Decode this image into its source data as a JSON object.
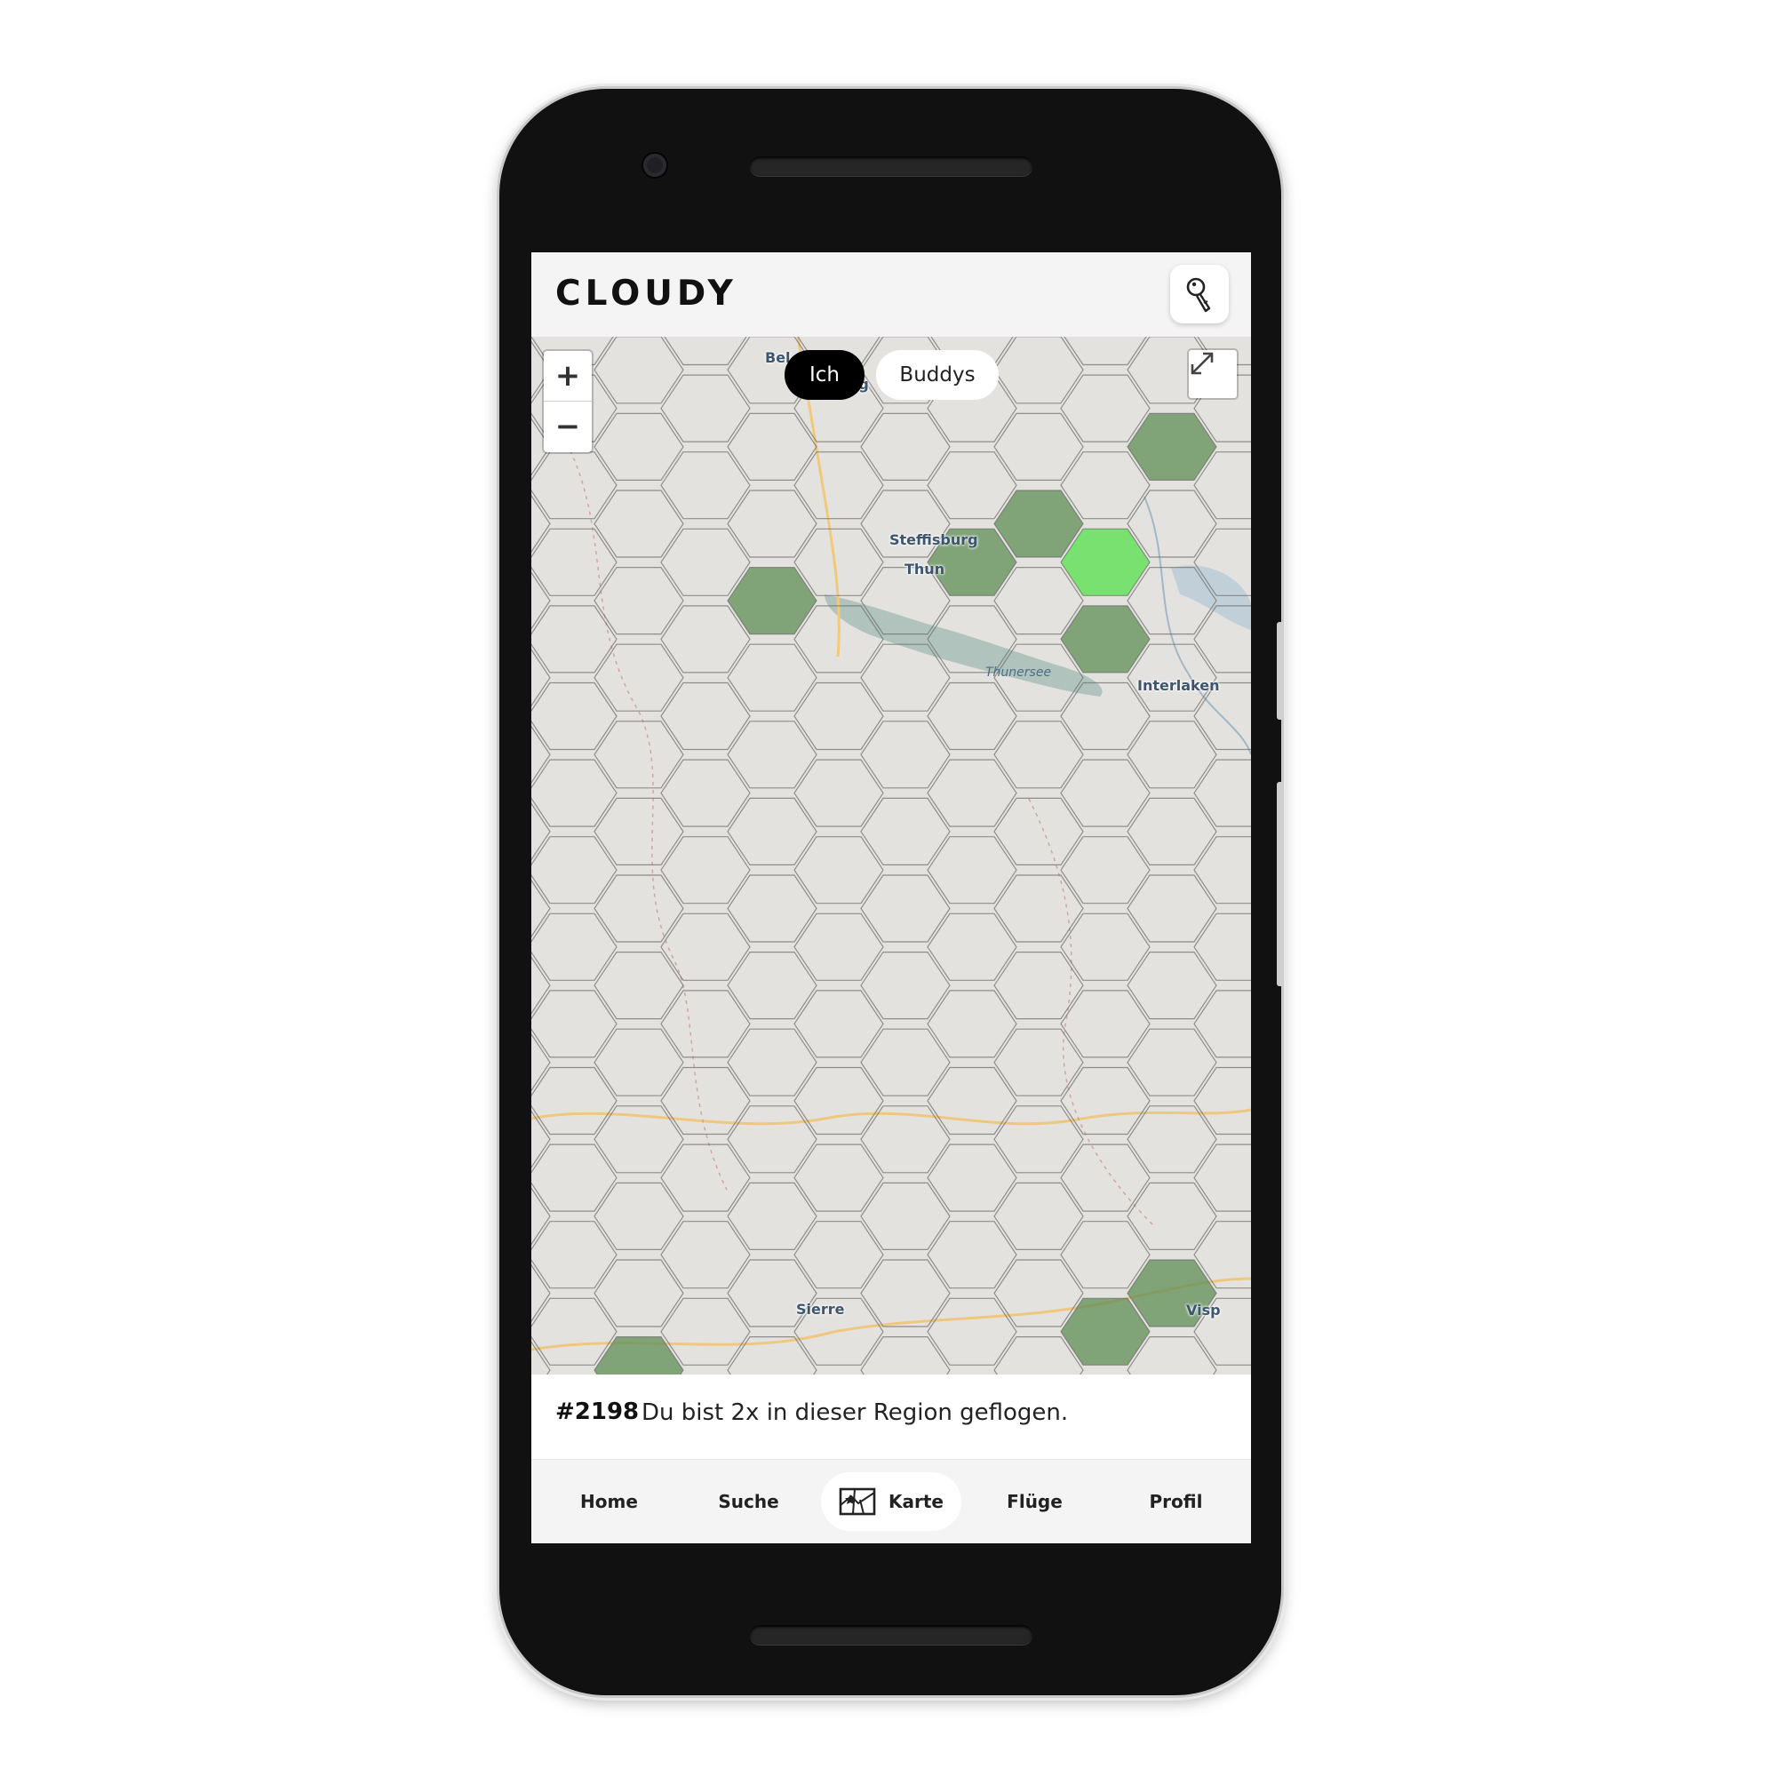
{
  "app": {
    "brand": "CLOUDY"
  },
  "header": {
    "search_icon": "search-key-icon"
  },
  "map": {
    "zoom_in_label": "+",
    "zoom_out_label": "−",
    "toggle": {
      "me_label": "Ich",
      "buddys_label": "Buddys",
      "selected": "Ich"
    },
    "fullscreen_icon": "expand-icon",
    "places": {
      "bern": "Bel",
      "ittigen": "ng",
      "steffisburg": "Steffisburg",
      "thun": "Thun",
      "thunersee": "Thunersee",
      "interlaken": "Interlaken",
      "sierre": "Sierre",
      "visp": "Visp"
    },
    "colors": {
      "visited": "#5f8d55",
      "highlight": "#55e04a",
      "selected": "#ffffff",
      "grid_line": "#707070",
      "base": "#e4e2de"
    }
  },
  "info": {
    "hex_id": "#2198",
    "message": "Du bist 2x in dieser Region geflogen."
  },
  "nav": {
    "items": [
      {
        "label": "Home"
      },
      {
        "label": "Suche"
      },
      {
        "label": "Karte",
        "icon": "map-icon",
        "active": true
      },
      {
        "label": "Flüge"
      },
      {
        "label": "Profil"
      }
    ]
  }
}
